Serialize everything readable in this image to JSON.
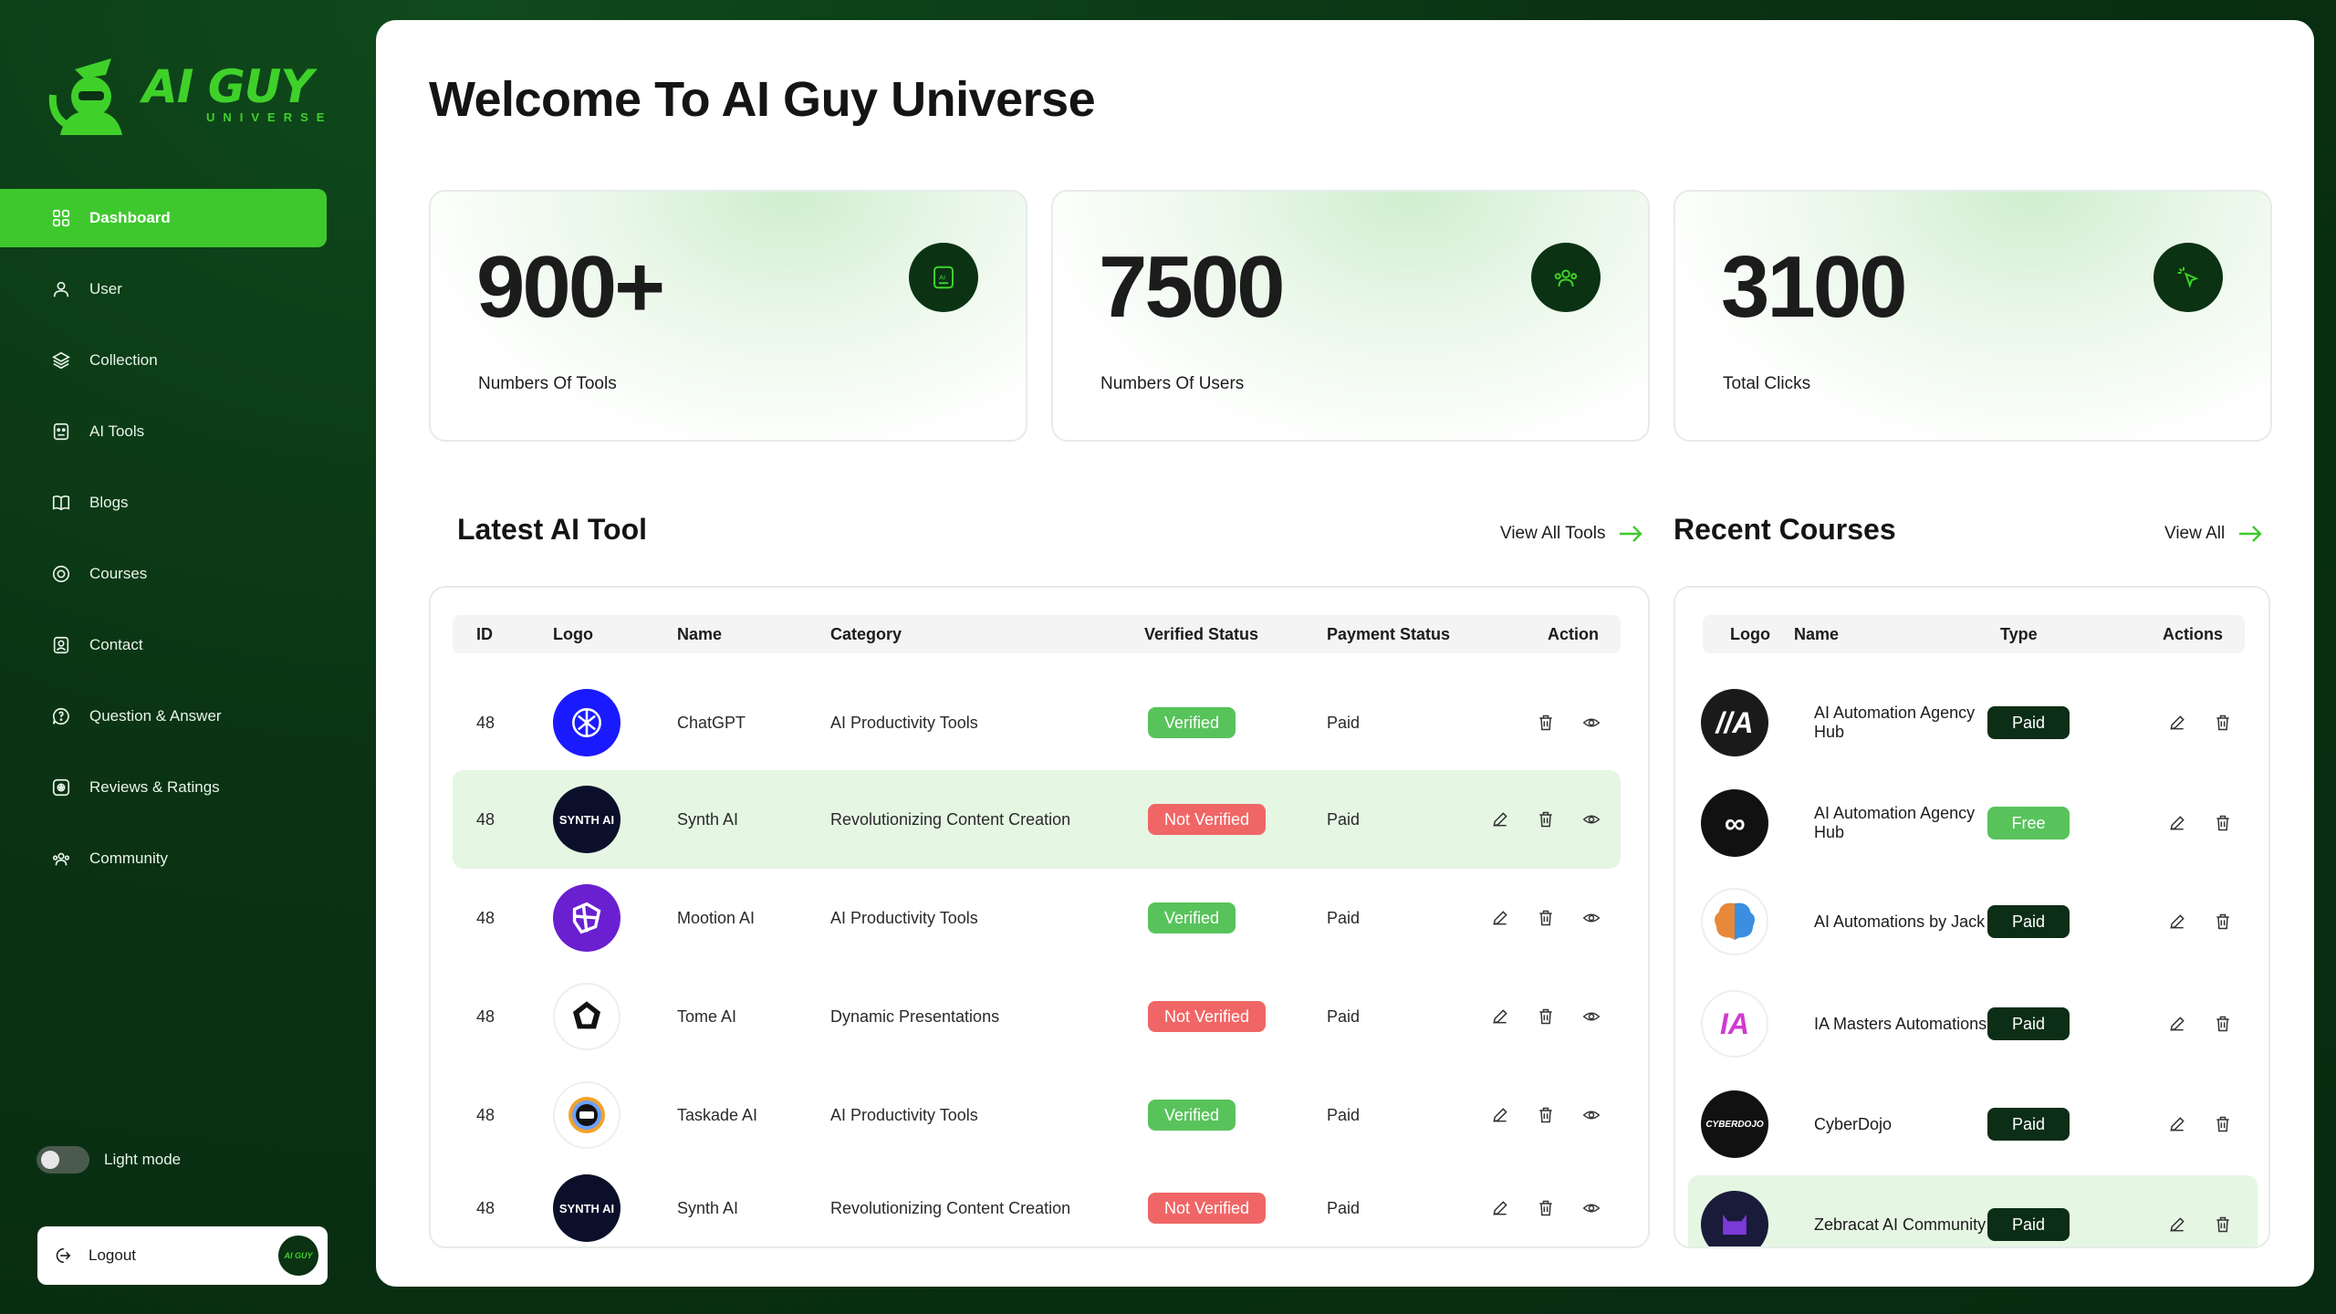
{
  "brand": {
    "name": "AI GUY",
    "sub": "UNIVERSE",
    "badge": "AI GUY"
  },
  "nav": [
    {
      "label": "Dashboard",
      "icon": "grid-icon",
      "active": true
    },
    {
      "label": "User",
      "icon": "user-icon"
    },
    {
      "label": "Collection",
      "icon": "layers-icon"
    },
    {
      "label": "AI Tools",
      "icon": "robot-icon"
    },
    {
      "label": "Blogs",
      "icon": "book-icon"
    },
    {
      "label": "Courses",
      "icon": "courses-icon"
    },
    {
      "label": "Contact",
      "icon": "contact-icon"
    },
    {
      "label": "Question & Answer",
      "icon": "question-icon"
    },
    {
      "label": "Reviews & Ratings",
      "icon": "rating-icon"
    },
    {
      "label": "Community",
      "icon": "community-icon"
    }
  ],
  "theme_toggle": {
    "label": "Light mode"
  },
  "logout": {
    "label": "Logout"
  },
  "page": {
    "title": "Welcome To AI Guy Universe"
  },
  "stats": [
    {
      "value": "900+",
      "label": "Numbers Of Tools",
      "icon": "ai-chip-icon"
    },
    {
      "value": "7500",
      "label": "Numbers Of Users",
      "icon": "users-icon"
    },
    {
      "value": "3100",
      "label": "Total Clicks",
      "icon": "click-icon"
    }
  ],
  "tools": {
    "title": "Latest AI Tool",
    "view_all": "View All Tools",
    "columns": [
      "ID",
      "Logo",
      "Name",
      "Category",
      "Verified Status",
      "Payment Status",
      "Action"
    ],
    "rows": [
      {
        "id": "48",
        "logo": "chatgpt-logo",
        "logo_text": "",
        "logo_color": "#1a1aff",
        "name": "ChatGPT",
        "category": "AI Productivity Tools",
        "verified": "Verified",
        "payment": "Paid",
        "editable": false,
        "highlight": false
      },
      {
        "id": "48",
        "logo": "synth-ai-logo",
        "logo_text": "SYNTH AI",
        "logo_color": "#0b0f2a",
        "name": "Synth AI",
        "category": "Revolutionizing Content Creation",
        "verified": "Not Verified",
        "payment": "Paid",
        "editable": true,
        "highlight": true
      },
      {
        "id": "48",
        "logo": "mootion-ai-logo",
        "logo_text": "",
        "logo_color": "#6a1fd0",
        "name": "Mootion AI",
        "category": "AI Productivity Tools",
        "verified": "Verified",
        "payment": "Paid",
        "editable": true,
        "highlight": false
      },
      {
        "id": "48",
        "logo": "tome-ai-logo",
        "logo_text": "",
        "logo_color": "#ffffff",
        "name": "Tome AI",
        "category": "Dynamic Presentations",
        "verified": "Not Verified",
        "payment": "Paid",
        "editable": true,
        "highlight": false
      },
      {
        "id": "48",
        "logo": "taskade-ai-logo",
        "logo_text": "",
        "logo_color": "#ffffff",
        "name": "Taskade AI",
        "category": "AI Productivity Tools",
        "verified": "Verified",
        "payment": "Paid",
        "editable": true,
        "highlight": false
      },
      {
        "id": "48",
        "logo": "synth-ai-logo",
        "logo_text": "SYNTH AI",
        "logo_color": "#0b0f2a",
        "name": "Synth AI",
        "category": "Revolutionizing Content Creation",
        "verified": "Not Verified",
        "payment": "Paid",
        "editable": true,
        "highlight": false
      }
    ]
  },
  "courses": {
    "title": "Recent Courses",
    "view_all": "View All",
    "columns": [
      "Logo",
      "Name",
      "Type",
      "Actions"
    ],
    "rows": [
      {
        "logo": "ai-automation-agency-logo",
        "logo_text": "//A",
        "logo_color": "#1a1a1a",
        "name": "AI Automation Agency Hub",
        "type": "Paid"
      },
      {
        "logo": "infinity-logo",
        "logo_text": "∞",
        "logo_color": "#111111",
        "name": "AI Automation Agency Hub",
        "type": "Free"
      },
      {
        "logo": "brain-logo",
        "logo_text": "",
        "logo_color": "#ffffff",
        "name": "AI Automations by Jack",
        "type": "Paid"
      },
      {
        "logo": "ia-masters-logo",
        "logo_text": "IA",
        "logo_color": "#ffffff",
        "name": "IA Masters Automations",
        "type": "Paid"
      },
      {
        "logo": "cyberdojo-logo",
        "logo_text": "CYBERDOJO",
        "logo_color": "#111111",
        "name": "CyberDojo",
        "type": "Paid"
      },
      {
        "logo": "zebracat-logo",
        "logo_text": "",
        "logo_color": "#1a1a3a",
        "name": "Zebracat AI Community",
        "type": "Paid"
      }
    ]
  },
  "colors": {
    "accent": "#3fc82e",
    "dark": "#0a3213",
    "verified": "#58c35b",
    "not_verified": "#f06666"
  }
}
